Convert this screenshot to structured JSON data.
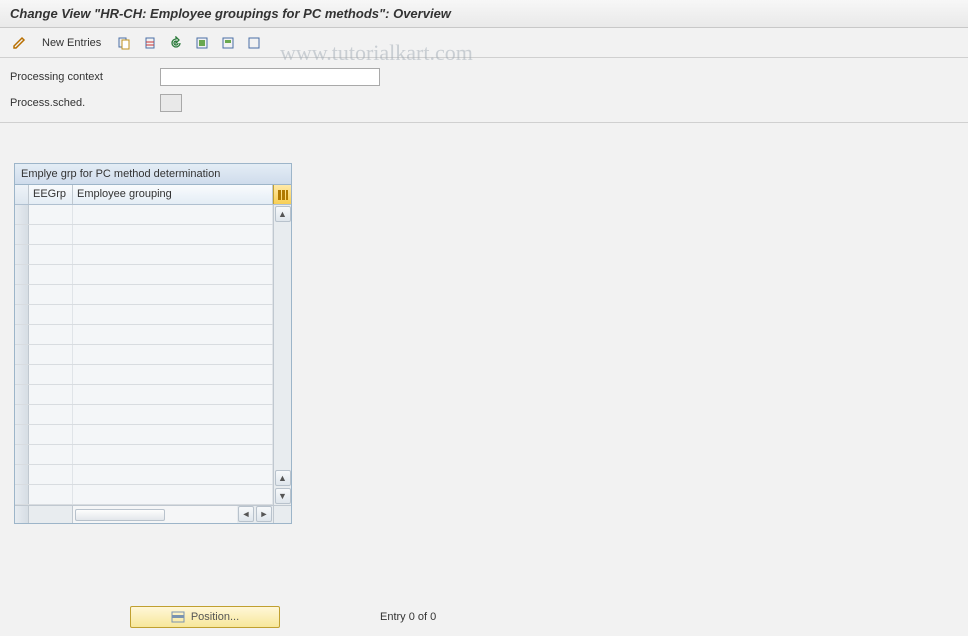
{
  "title": "Change View \"HR-CH: Employee groupings for PC methods\": Overview",
  "toolbar": {
    "new_entries": "New Entries"
  },
  "form": {
    "processing_context_label": "Processing context",
    "processing_context_value": "",
    "process_sched_label": "Process.sched.",
    "process_sched_value": ""
  },
  "grid": {
    "title": "Emplye grp for PC method determination",
    "columns": {
      "eegrp": "EEGrp",
      "grouping": "Employee grouping"
    },
    "rows": 15
  },
  "footer": {
    "position_label": "Position...",
    "entry_text": "Entry 0 of 0"
  },
  "watermark": "www.tutorialkart.com"
}
